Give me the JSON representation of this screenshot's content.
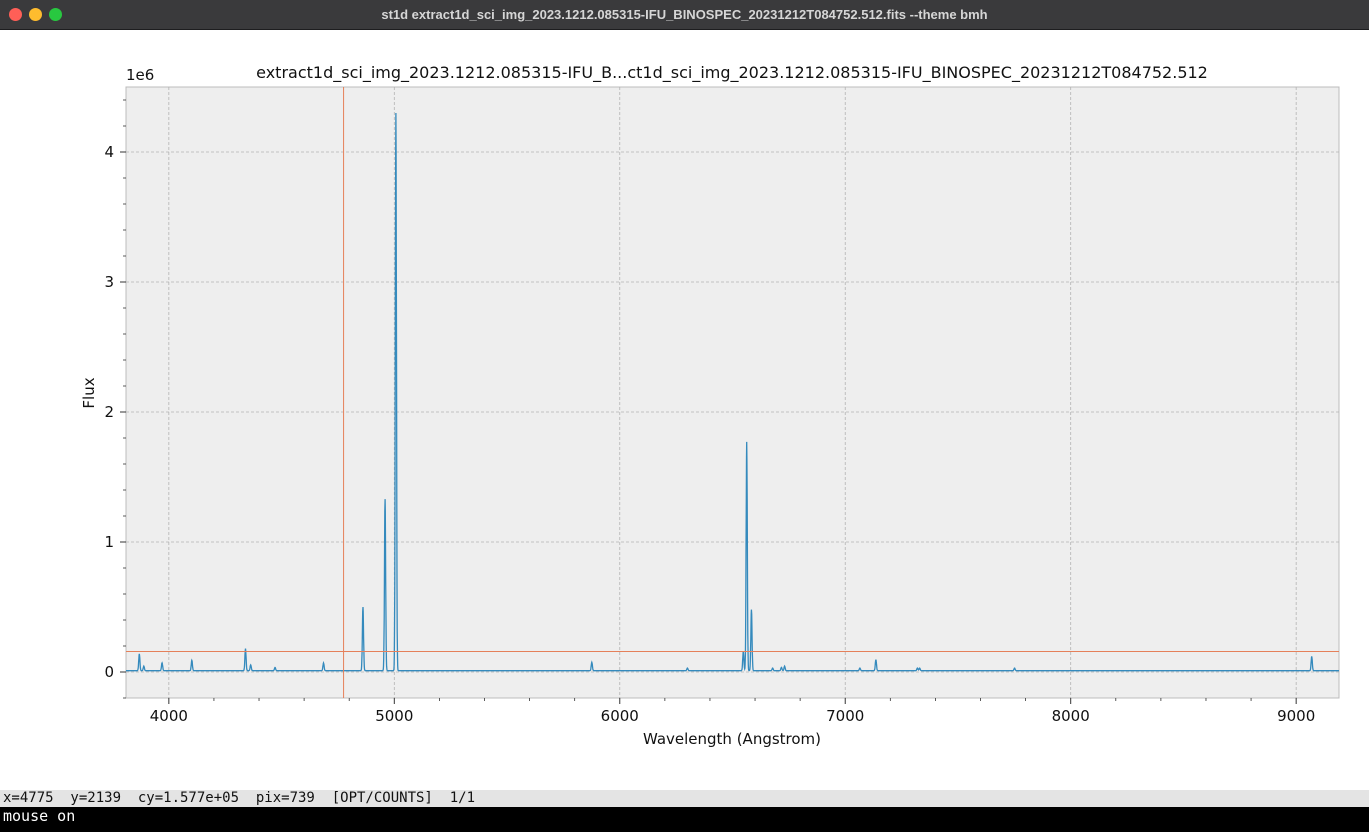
{
  "window": {
    "title": "st1d extract1d_sci_img_2023.1212.085315-IFU_BINOSPEC_20231212T084752.512.fits --theme bmh"
  },
  "plot": {
    "title": "extract1d_sci_img_2023.1212.085315-IFU_B...ct1d_sci_img_2023.1212.085315-IFU_BINOSPEC_20231212T084752.512",
    "offset_label": "1e6"
  },
  "chart_data": {
    "type": "line",
    "title": "extract1d_sci_img_2023.1212.085315-IFU_B...ct1d_sci_img_2023.1212.085315-IFU_BINOSPEC_20231212T084752.512",
    "xlabel": "Wavelength (Angstrom)",
    "ylabel": "Flux",
    "y_scale_label": "1e6",
    "xlim": [
      3810,
      9190
    ],
    "ylim": [
      -200000,
      4500000
    ],
    "x_ticks": [
      4000,
      5000,
      6000,
      7000,
      8000,
      9000
    ],
    "x_tick_labels": [
      "4000",
      "5000",
      "6000",
      "7000",
      "8000",
      "9000"
    ],
    "y_ticks": [
      0,
      1000000,
      2000000,
      3000000,
      4000000
    ],
    "y_tick_labels": [
      "0",
      "1",
      "2",
      "3",
      "4"
    ],
    "grid": true,
    "colors": {
      "series": "#348abd",
      "cursor": "#e5805a",
      "axes_bg": "#eeeeee",
      "grid": "#b2b2b2"
    },
    "continuum": 10000,
    "lines": [
      {
        "x": 3869,
        "y": 130000
      },
      {
        "x": 3889,
        "y": 35000
      },
      {
        "x": 3970,
        "y": 60000
      },
      {
        "x": 4102,
        "y": 80000
      },
      {
        "x": 4340,
        "y": 170000
      },
      {
        "x": 4363,
        "y": 45000
      },
      {
        "x": 4471,
        "y": 25000
      },
      {
        "x": 4686,
        "y": 60000
      },
      {
        "x": 4861,
        "y": 490000
      },
      {
        "x": 4959,
        "y": 1320000
      },
      {
        "x": 5007,
        "y": 4290000
      },
      {
        "x": 5876,
        "y": 65000
      },
      {
        "x": 6300,
        "y": 20000
      },
      {
        "x": 6548,
        "y": 150000
      },
      {
        "x": 6563,
        "y": 1760000
      },
      {
        "x": 6584,
        "y": 470000
      },
      {
        "x": 6678,
        "y": 20000
      },
      {
        "x": 6717,
        "y": 25000
      },
      {
        "x": 6731,
        "y": 35000
      },
      {
        "x": 7065,
        "y": 20000
      },
      {
        "x": 7136,
        "y": 85000
      },
      {
        "x": 7320,
        "y": 20000
      },
      {
        "x": 7330,
        "y": 20000
      },
      {
        "x": 7751,
        "y": 20000
      },
      {
        "x": 9069,
        "y": 110000
      }
    ],
    "cursor": {
      "x": 4775,
      "y": 157700
    }
  },
  "status": {
    "text": "x=4775  y=2139  cy=1.577e+05  pix=739  [OPT/COUNTS]  1/1"
  },
  "command": {
    "text": "mouse on"
  }
}
